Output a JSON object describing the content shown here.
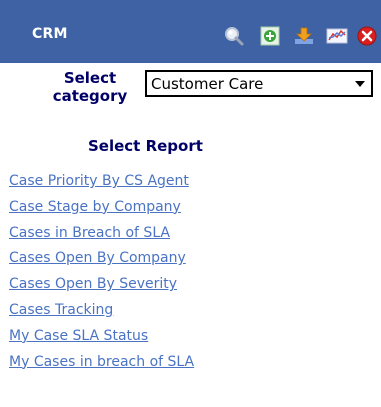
{
  "header": {
    "title": "CRM",
    "toolbar": [
      {
        "icon": "search-icon",
        "color": "#cfcfcf"
      },
      {
        "icon": "add-icon",
        "color": "#3aa33a"
      },
      {
        "icon": "download-icon",
        "color": "#f0a020"
      },
      {
        "icon": "chart-icon",
        "color": "#5b7fd0"
      },
      {
        "icon": "close-icon",
        "color": "#d92020"
      }
    ],
    "background": "#3f62a4"
  },
  "category": {
    "label": "Select category",
    "selected": "Customer Care"
  },
  "reports": {
    "heading": "Select Report",
    "items": [
      "Case Priority By CS Agent",
      "Case Stage by Company",
      "Cases in Breach of SLA",
      "Cases Open By Company",
      "Cases Open By Severity",
      "Cases Tracking",
      "My Case SLA Status",
      "My Cases in breach of SLA"
    ],
    "link_color": "#4a73c4"
  }
}
